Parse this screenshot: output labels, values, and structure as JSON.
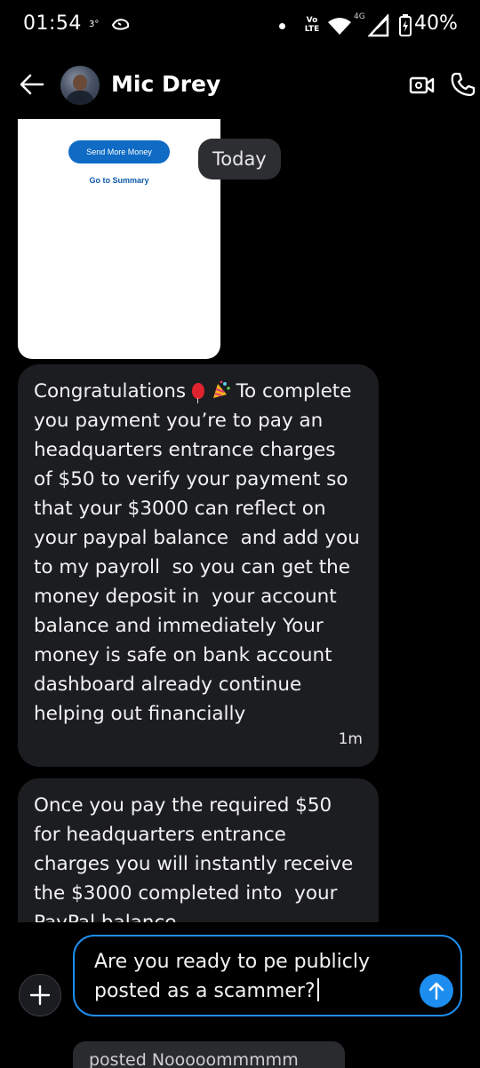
{
  "status_bar": {
    "time": "01:54",
    "superscript": "3°",
    "network_label": "Vo LTE",
    "data_label": "4G",
    "battery": "40%",
    "icons": [
      "bird-icon",
      "dot-icon",
      "volte-icon",
      "wifi-icon",
      "signal-icon",
      "battery-charging-icon"
    ]
  },
  "header": {
    "contact_name": "Mic Drey",
    "icons": [
      "back-arrow-icon",
      "avatar",
      "video-call-icon",
      "phone-icon"
    ]
  },
  "chat": {
    "image_card": {
      "primary_button": "Send More Money",
      "link": "Go to Summary"
    },
    "date_chip": "Today",
    "messages": [
      {
        "lead": "Congratulations ",
        "text": " To complete you payment you’re to pay an headquarters entrance charges  of $50 to verify your payment so that your $3000 can reflect on your paypal balance  and add you to my payroll  so you can get the money deposit in  your account balance and immediately Your money is safe on bank account dashboard already continue helping out financially",
        "time": "1m"
      },
      {
        "text": "Once you pay the required $50 for headquarters entrance charges you will instantly receive the $3000 completed into  your PayPal balance"
      }
    ]
  },
  "composer": {
    "input_text": "Are you ready to pe publicly posted as a scammer?",
    "suggestion": "posted  Nooooommmmm"
  },
  "colors": {
    "background": "#000000",
    "bubble": "#1c1d20",
    "accent": "#1d8ef0",
    "paypal_blue": "#0f6bc4"
  }
}
